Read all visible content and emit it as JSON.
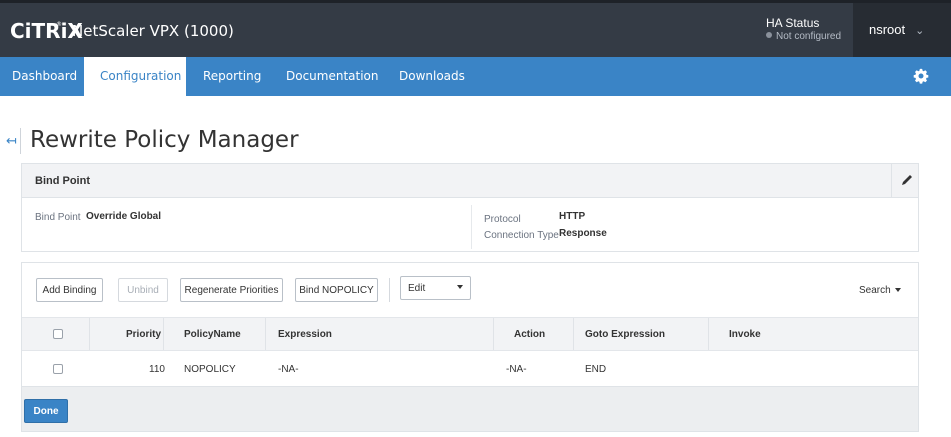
{
  "header": {
    "logo_text": "CiTRiX",
    "logo_mark": "®",
    "product": "NetScaler VPX (1000)",
    "ha_title": "HA Status",
    "ha_status": "Not configured",
    "user": "nsroot"
  },
  "nav": {
    "tabs": [
      {
        "label": "Dashboard"
      },
      {
        "label": "Configuration"
      },
      {
        "label": "Reporting"
      },
      {
        "label": "Documentation"
      },
      {
        "label": "Downloads"
      }
    ],
    "active_tab": "Configuration"
  },
  "page": {
    "back_glyph": "↤",
    "title": "Rewrite Policy Manager"
  },
  "bind_point_panel": {
    "title": "Bind Point",
    "bind_point_label": "Bind Point",
    "bind_point_value": "Override Global",
    "protocol_label": "Protocol",
    "protocol_value": "HTTP",
    "connection_type_label": "Connection Type",
    "connection_type_value": "Response"
  },
  "toolbar": {
    "add_binding": "Add Binding",
    "unbind": "Unbind",
    "regenerate_priorities": "Regenerate Priorities",
    "bind_nopolicy": "Bind NOPOLICY",
    "edit_select": "Edit",
    "search": "Search"
  },
  "table": {
    "columns": [
      "Priority",
      "PolicyName",
      "Expression",
      "Action",
      "Goto Expression",
      "Invoke"
    ],
    "rows": [
      {
        "priority": "110",
        "policy_name": "NOPOLICY",
        "expression": "-NA-",
        "action": "-NA-",
        "goto_expression": "END",
        "invoke": ""
      }
    ]
  },
  "footer": {
    "done": "Done"
  },
  "colors": {
    "header_bg": "#343b45",
    "nav_bg": "#3a84c6",
    "accent": "#3a84c6"
  }
}
